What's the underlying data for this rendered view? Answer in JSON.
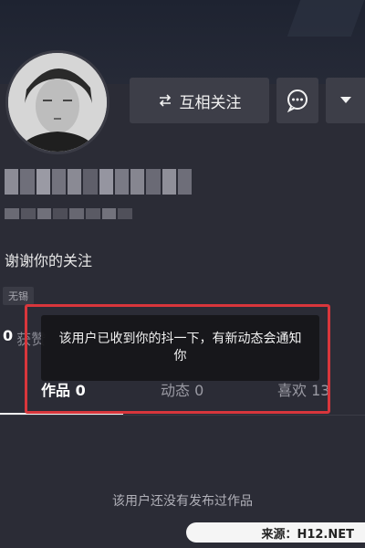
{
  "header": {
    "follow_button_label": "互相关注",
    "follow_icon": "swap-arrows-icon",
    "message_icon": "chat-bubble-icon",
    "more_icon": "caret-down-icon"
  },
  "profile": {
    "bio": "谢谢你的关注",
    "tag": "无锡",
    "stats_value": "0",
    "stats_label": "获赞"
  },
  "tabs": [
    {
      "label": "作品 0",
      "active": true
    },
    {
      "label": "动态 0",
      "active": false
    },
    {
      "label": "喜欢 13",
      "active": false
    }
  ],
  "toast": {
    "message": "该用户已收到你的抖一下，有新动态会通知你"
  },
  "empty_state": {
    "message": "该用户还没有发布过作品"
  },
  "watermark": {
    "text": "来源：H12.NET"
  },
  "colors": {
    "background": "#2b2c36",
    "button_bg": "#3d3e48",
    "highlight": "#d8363c"
  }
}
